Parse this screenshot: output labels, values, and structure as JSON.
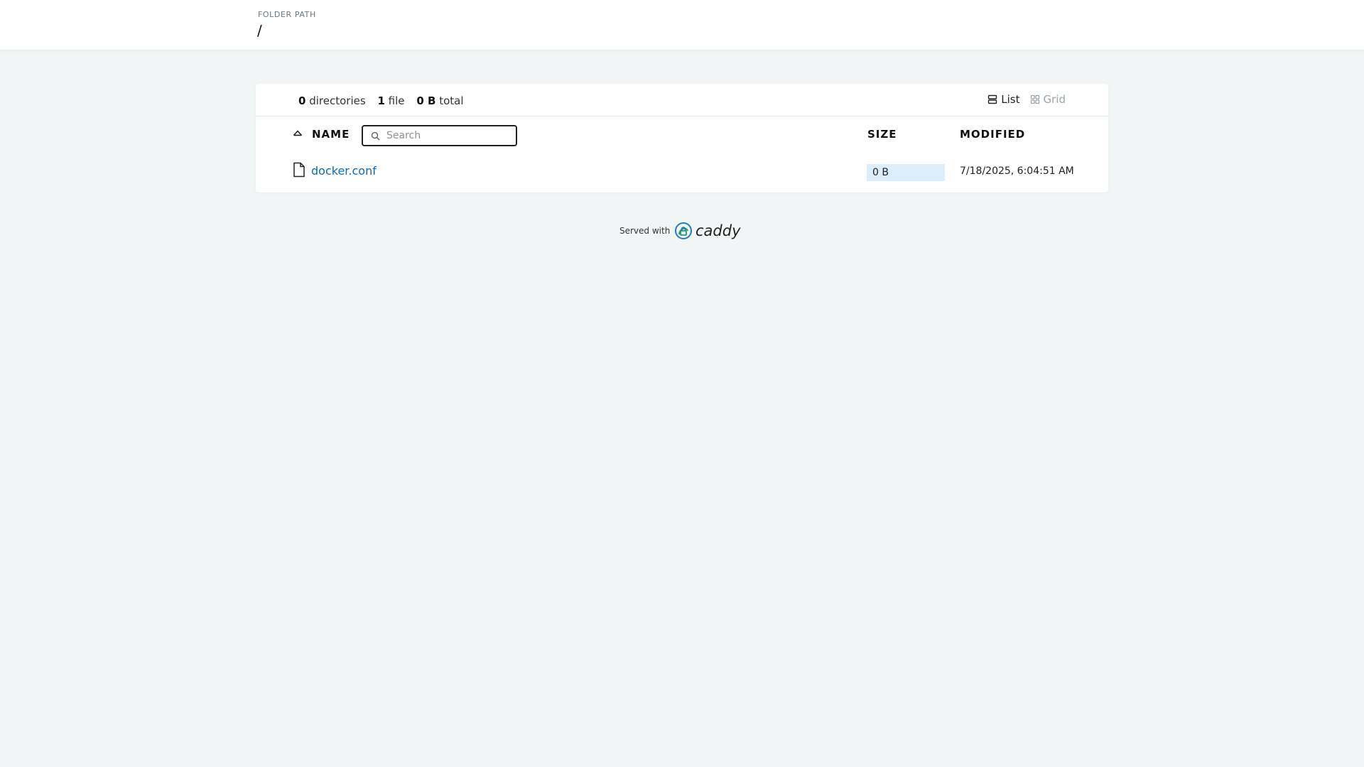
{
  "header": {
    "folder_path_label": "FOLDER PATH",
    "folder_path": "/"
  },
  "summary": {
    "directories_count": "0",
    "directories_label": "directories",
    "files_count": "1",
    "files_label": "file",
    "total_size": "0 B",
    "total_label": "total"
  },
  "view_toggle": {
    "list_label": "List",
    "grid_label": "Grid",
    "active": "list"
  },
  "table": {
    "columns": {
      "name": "NAME",
      "size": "SIZE",
      "modified": "MODIFIED"
    },
    "search_placeholder": "Search",
    "search_value": "",
    "rows": [
      {
        "name": "docker.conf",
        "size": "0 B",
        "size_fill": 1.0,
        "modified": "7/18/2025, 6:04:51 AM",
        "icon": "file-icon"
      }
    ]
  },
  "footer": {
    "served_with": "Served with",
    "logo_text": "caddy"
  },
  "colors": {
    "page_bg": "#f1f5f6",
    "link": "#0a6bb8",
    "size_bar": "#dceefb",
    "caddy_green": "#1f9e6e",
    "caddy_blue": "#1d7fc1"
  }
}
